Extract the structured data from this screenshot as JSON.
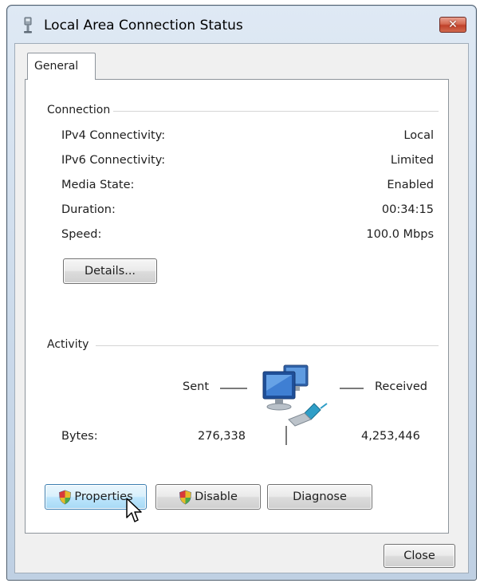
{
  "window": {
    "title": "Local Area Connection Status",
    "close_glyph": "✕",
    "accent": "#c0412a"
  },
  "tabs": [
    {
      "label": "General",
      "selected": true
    }
  ],
  "connection": {
    "heading": "Connection",
    "rows": [
      {
        "label": "IPv4 Connectivity:",
        "value": "Local"
      },
      {
        "label": "IPv6 Connectivity:",
        "value": "Limited"
      },
      {
        "label": "Media State:",
        "value": "Enabled"
      },
      {
        "label": "Duration:",
        "value": "00:34:15"
      },
      {
        "label": "Speed:",
        "value": "100.0 Mbps"
      }
    ],
    "details_button": "Details..."
  },
  "activity": {
    "heading": "Activity",
    "sent_label": "Sent",
    "received_label": "Received",
    "bytes_label": "Bytes:",
    "bytes_sent": "276,338",
    "bytes_received": "4,253,446",
    "icon": "network-computers-icon"
  },
  "actions": {
    "properties": "Properties",
    "disable": "Disable",
    "diagnose": "Diagnose"
  },
  "footer": {
    "close": "Close"
  },
  "icons": {
    "title": "network-adapter-icon",
    "shield": "uac-shield-icon",
    "cursor": "mouse-pointer-icon"
  }
}
